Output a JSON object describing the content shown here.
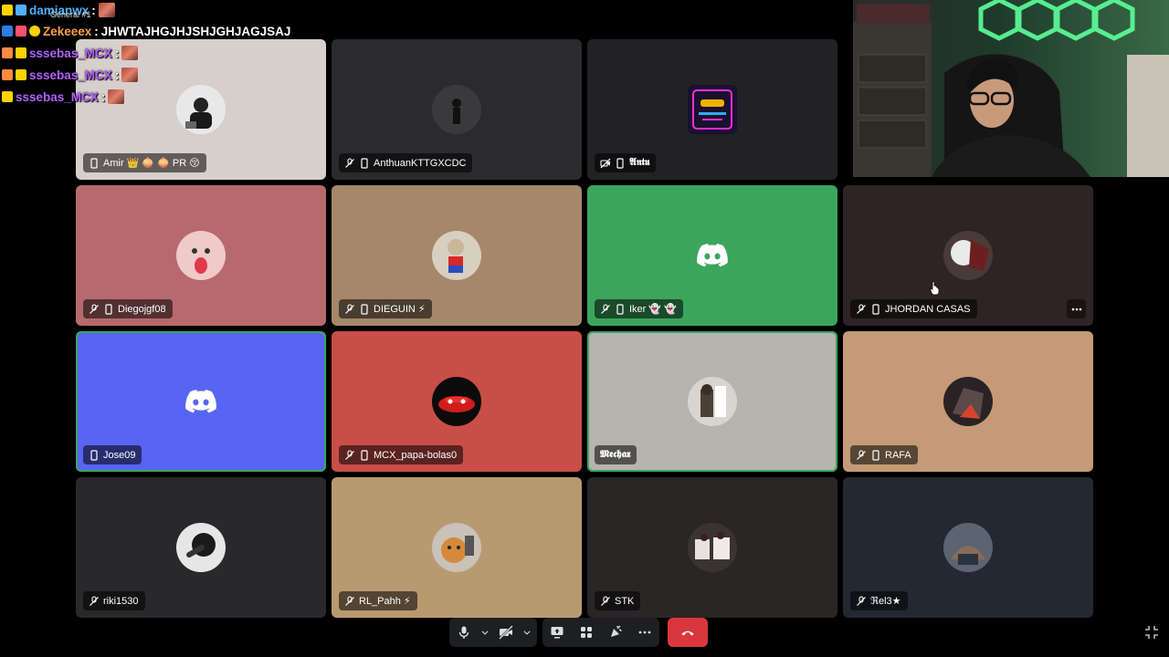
{
  "chat": {
    "channel_tooltip": "General #1",
    "messages": [
      {
        "user": "damianwx",
        "sep": " :",
        "text": "",
        "color": "#4fb0ff"
      },
      {
        "user": "Zekeeex",
        "sep": " :",
        "text": "JHWTAJHGJHJSHJGHJAGJSAJ",
        "color": "#ff9f43"
      },
      {
        "user": "sssebas_MCX",
        "sep": " :",
        "text": "",
        "color": "#b061ff"
      },
      {
        "user": "sssebas_MCX",
        "sep": " :",
        "text": "",
        "color": "#b061ff"
      },
      {
        "user": "sssebas_MCX",
        "sep": " :",
        "text": "",
        "color": "#b061ff"
      }
    ]
  },
  "participants": [
    {
      "name": "Amir 👑 🧅 🧅 PR 😚",
      "bg": "#d6cfcc",
      "avatar": "photo",
      "muted": false,
      "mobile": true
    },
    {
      "name": "AnthuanKTTGXCDC",
      "bg": "#2b2b2e",
      "avatar": "photo",
      "muted": true,
      "mobile": true
    },
    {
      "name": "𝕬𝖓𝖙𝖚",
      "bg": "#222224",
      "avatar": "art",
      "muted": true,
      "mobile": true,
      "video_off": true
    },
    {
      "name": "Diegojgf08",
      "bg": "#b66a6e",
      "avatar": "face",
      "muted": true,
      "mobile": true
    },
    {
      "name": "DIEGUIN ⚡",
      "bg": "#a5876a",
      "avatar": "photo",
      "muted": true,
      "mobile": true
    },
    {
      "name": "Iker 👻 👻",
      "bg": "#3ba55c",
      "avatar": "discord",
      "muted": true,
      "mobile": true
    },
    {
      "name": "JHORDAN CASAS",
      "bg": "#2e2425",
      "avatar": "photo",
      "muted": true,
      "mobile": true,
      "more": true
    },
    {
      "name": "Jose09",
      "bg": "#5865f2",
      "avatar": "discord",
      "muted": false,
      "mobile": true,
      "speaking": true
    },
    {
      "name": "MCX_papa-bolas0",
      "bg": "#c94e48",
      "avatar": "car",
      "muted": true,
      "mobile": true
    },
    {
      "name": "𝕸𝖊𝖈𝖍𝖆𝖝",
      "bg": "#b7b3ad",
      "avatar": "photo",
      "muted": false,
      "mobile": false,
      "speaking": true
    },
    {
      "name": "RAFA",
      "bg": "#c49b76",
      "avatar": "photo",
      "muted": true,
      "mobile": true
    },
    {
      "name": "riki1530",
      "bg": "#29292b",
      "avatar": "photo",
      "muted": true,
      "mobile": false
    },
    {
      "name": "RL_Pahh ⚡",
      "bg": "#b89a70",
      "avatar": "cat",
      "muted": true,
      "mobile": false
    },
    {
      "name": "STK",
      "bg": "#2a2626",
      "avatar": "photo",
      "muted": true,
      "mobile": false
    },
    {
      "name": "ℜel3★",
      "bg": "#232833",
      "avatar": "photo",
      "muted": true,
      "mobile": false
    }
  ],
  "icons": {
    "mute": "microphone-slash-icon",
    "mobile": "mobile-phone-icon",
    "more": "more-options-icon"
  },
  "controls": {
    "microphone": "microphone-icon",
    "camera": "camera-off-icon",
    "screen_share": "screen-share-icon",
    "activities": "activities-icon",
    "soundboard": "soundboard-icon",
    "more": "more-icon",
    "hangup": "hang-up-icon",
    "fullscreen": "exit-fullscreen-icon"
  }
}
